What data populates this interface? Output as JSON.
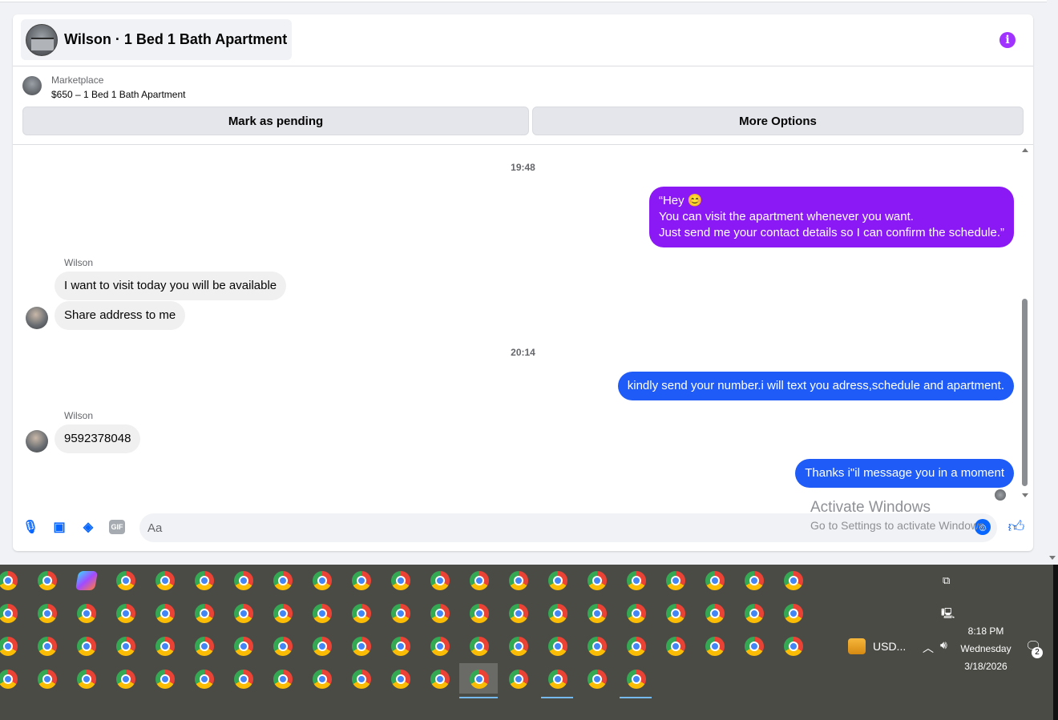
{
  "conversation": {
    "title": "Wilson · 1 Bed 1 Bath Apartment"
  },
  "listing": {
    "source": "Marketplace",
    "title": "$650 – 1 Bed 1 Bath Apartment"
  },
  "actions": {
    "mark_pending": "Mark as pending",
    "more_options": "More Options"
  },
  "messages": {
    "ts1": "19:48",
    "out1_line1": "“Hey 😊",
    "out1_line2": "You can visit the apartment whenever you want.",
    "out1_line3": "Just send me your contact details so I can confirm the schedule.”",
    "sender1": "Wilson",
    "in1": "I want to visit today you will be available",
    "in2": "Share address to me",
    "ts2": "20:14",
    "out2": "kindly send your number.i will text you adress,schedule and apartment.",
    "sender2": "Wilson",
    "in3": "9592378048",
    "out3": "Thanks i\"il message you in a moment"
  },
  "composer": {
    "placeholder": "Aa",
    "gif_label": "GIF"
  },
  "watermark": {
    "title": "Activate Windows",
    "subtitle": "Go to Settings to activate Windows."
  },
  "taskbar": {
    "tray_label": "USD...",
    "time": "8:18 PM",
    "day": "Wednesday",
    "date": "3/18/2026",
    "notification_count": "2"
  },
  "colors": {
    "outgoing_purple": "#8b19f5",
    "outgoing_blue": "#1e5bf7",
    "accent": "#0866ff",
    "info": "#a033ff"
  }
}
